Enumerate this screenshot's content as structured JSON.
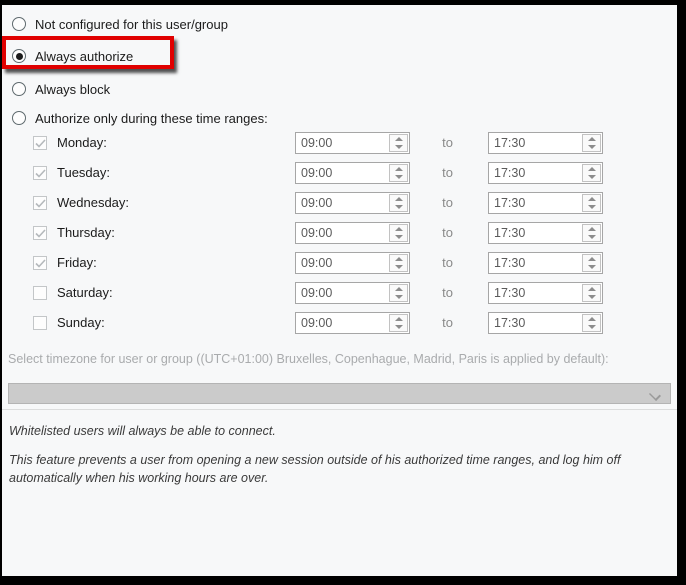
{
  "panel": {
    "radio_options": [
      {
        "label": "Not configured for this user/group",
        "selected": false
      },
      {
        "label": "Always authorize",
        "selected": true
      },
      {
        "label": "Always block",
        "selected": false
      },
      {
        "label": "Authorize only during these time ranges:",
        "selected": false
      }
    ],
    "highlight_color": "#e00000",
    "days": [
      {
        "label": "Monday:",
        "checked": true,
        "start": "09:00",
        "end": "17:30"
      },
      {
        "label": "Tuesday:",
        "checked": true,
        "start": "09:00",
        "end": "17:30"
      },
      {
        "label": "Wednesday:",
        "checked": true,
        "start": "09:00",
        "end": "17:30"
      },
      {
        "label": "Thursday:",
        "checked": true,
        "start": "09:00",
        "end": "17:30"
      },
      {
        "label": "Friday:",
        "checked": true,
        "start": "09:00",
        "end": "17:30"
      },
      {
        "label": "Saturday:",
        "checked": false,
        "start": "09:00",
        "end": "17:30"
      },
      {
        "label": "Sunday:",
        "checked": false,
        "start": "09:00",
        "end": "17:30"
      }
    ],
    "range_separator": "to",
    "timezone_label": "Select timezone for user or group ((UTC+01:00) Bruxelles, Copenhague, Madrid, Paris is applied by default):",
    "timezone_value": "",
    "notes": [
      "Whitelisted users will always be able to connect.",
      "This feature prevents a user from opening a new session outside of his authorized time ranges, and log him off automatically when his working hours are over."
    ]
  }
}
